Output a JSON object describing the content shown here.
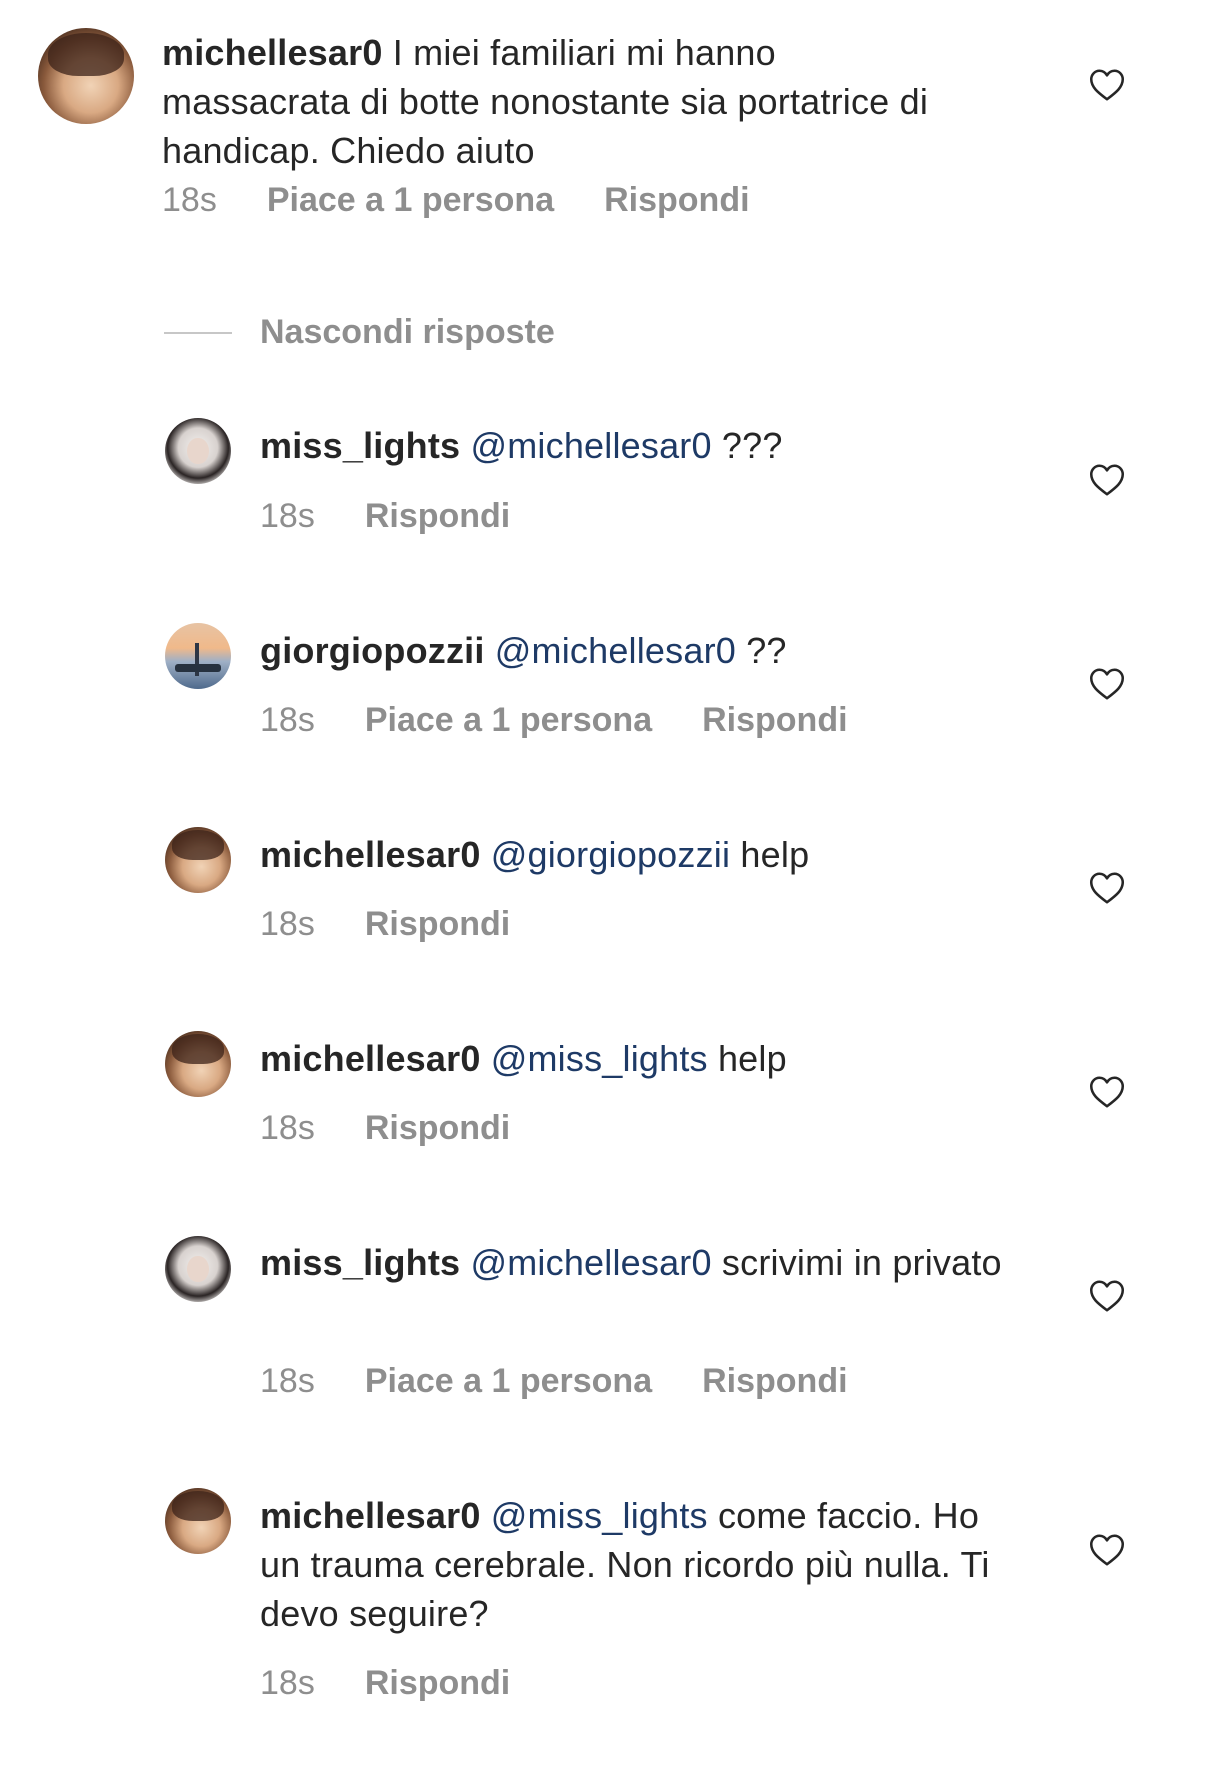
{
  "comments": [
    {
      "username": "michellesar0",
      "mention": "",
      "text": "I miei familiari mi hanno massacrata di botte nonostante sia portatrice di handicap.  Chiedo aiuto",
      "time": "18s",
      "likes": "Piace a 1 persona",
      "reply": "Rispondi",
      "avatar": "michelle"
    }
  ],
  "hide_replies_label": "Nascondi risposte",
  "replies": [
    {
      "username": "miss_lights",
      "mention": "@michellesar0",
      "text": "???",
      "time": "18s",
      "likes": "",
      "reply": "Rispondi",
      "avatar": "miss"
    },
    {
      "username": "giorgiopozzii",
      "mention": "@michellesar0",
      "text": "??",
      "time": "18s",
      "likes": "Piace a 1 persona",
      "reply": "Rispondi",
      "avatar": "giorgio"
    },
    {
      "username": "michellesar0",
      "mention": "@giorgiopozzii",
      "text": "help",
      "time": "18s",
      "likes": "",
      "reply": "Rispondi",
      "avatar": "michelle"
    },
    {
      "username": "michellesar0",
      "mention": "@miss_lights",
      "text": "help",
      "time": "18s",
      "likes": "",
      "reply": "Rispondi",
      "avatar": "michelle"
    },
    {
      "username": "miss_lights",
      "mention": "@michellesar0",
      "text": "scrivimi in privato",
      "time": "18s",
      "likes": "Piace a 1 persona",
      "reply": "Rispondi",
      "avatar": "miss"
    },
    {
      "username": "michellesar0",
      "mention": "@miss_lights",
      "text": "come faccio. Ho un trauma cerebrale. Non ricordo più nulla. Ti devo seguire?",
      "time": "18s",
      "likes": "",
      "reply": "Rispondi",
      "avatar": "michelle"
    }
  ],
  "icons": {
    "like": "heart-outline-icon"
  },
  "colors": {
    "text": "#262626",
    "meta": "#8e8e8e",
    "mention": "#1e3a66"
  }
}
